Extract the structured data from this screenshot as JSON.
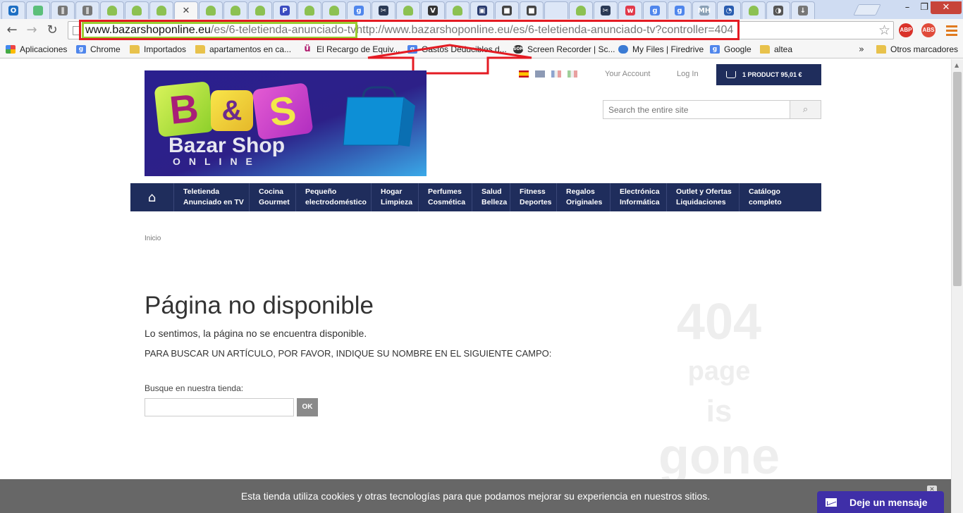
{
  "browser": {
    "tabs": [
      {
        "icon": "outlook-icon",
        "letter": "O",
        "color": "#1e6fc3"
      },
      {
        "icon": "cloud-icon",
        "letter": "",
        "color": "#5bbf7a"
      },
      {
        "icon": "doc-icon",
        "letter": "∥",
        "color": "#777777"
      },
      {
        "icon": "doc-icon",
        "letter": "∥",
        "color": "#777777"
      },
      {
        "icon": "android-icon",
        "letter": "",
        "color": "#8cc152"
      },
      {
        "icon": "android-icon",
        "letter": "",
        "color": "#8cc152"
      },
      {
        "icon": "android-icon",
        "letter": "",
        "color": "#8cc152"
      },
      {
        "icon": "close-icon",
        "letter": "✕",
        "color": "",
        "active": true
      },
      {
        "icon": "android-icon",
        "letter": "",
        "color": "#8cc152"
      },
      {
        "icon": "android-icon",
        "letter": "",
        "color": "#8cc152"
      },
      {
        "icon": "android-icon",
        "letter": "",
        "color": "#8cc152"
      },
      {
        "icon": "p-icon",
        "letter": "P",
        "color": "#3b4cc0"
      },
      {
        "icon": "android-icon",
        "letter": "",
        "color": "#8cc152"
      },
      {
        "icon": "android-icon",
        "letter": "",
        "color": "#8cc152"
      },
      {
        "icon": "google-icon",
        "letter": "g",
        "color": "#4f86ec"
      },
      {
        "icon": "scissors-icon",
        "letter": "✂",
        "color": "#2b3a55"
      },
      {
        "icon": "android-icon",
        "letter": "",
        "color": "#8cc152"
      },
      {
        "icon": "v-icon",
        "letter": "V",
        "color": "#333333"
      },
      {
        "icon": "android-icon",
        "letter": "",
        "color": "#8cc152"
      },
      {
        "icon": "chart-icon",
        "letter": "▣",
        "color": "#2a3b6e"
      },
      {
        "icon": "bag-icon",
        "letter": "■",
        "color": "#444444"
      },
      {
        "icon": "bag-icon",
        "letter": "■",
        "color": "#444444"
      },
      {
        "icon": "blank-icon",
        "letter": "",
        "color": ""
      },
      {
        "icon": "android-icon",
        "letter": "",
        "color": "#8cc152"
      },
      {
        "icon": "scissors-icon",
        "letter": "✂",
        "color": "#2b3a55"
      },
      {
        "icon": "w-icon",
        "letter": "w",
        "color": "#e23a4b"
      },
      {
        "icon": "google-icon",
        "letter": "g",
        "color": "#4f86ec"
      },
      {
        "icon": "google-icon",
        "letter": "g",
        "color": "#4f86ec"
      },
      {
        "icon": "mh-icon",
        "letter": "MH",
        "color": "#8aa0b5"
      },
      {
        "icon": "circle-icon",
        "letter": "◔",
        "color": "#2a5db0"
      },
      {
        "icon": "android-icon",
        "letter": "",
        "color": "#8cc152"
      },
      {
        "icon": "speedometer-icon",
        "letter": "◑",
        "color": "#555555"
      },
      {
        "icon": "download-icon",
        "letter": "↓",
        "color": "#777777"
      }
    ],
    "window_controls": {
      "minimize": "–",
      "maximize": "❐",
      "close": "✕"
    },
    "nav": {
      "back": "←",
      "forward": "→",
      "reload": "↻"
    },
    "url": {
      "domain": "www.bazarshoponline.eu",
      "path": "/es/6-teletienda-anunciado-tv",
      "typed": "http://www.bazarshoponline.eu/es/6-teletienda-anunciado-tv?controller=404"
    },
    "star": "☆",
    "extensions": {
      "abp": "ABP",
      "abs": "ABS"
    },
    "bookmarks": [
      {
        "icon": "apps",
        "label": "Aplicaciones"
      },
      {
        "icon": "g",
        "label": "Chrome"
      },
      {
        "icon": "folder",
        "label": "Importados"
      },
      {
        "icon": "folder",
        "label": "apartamentos en ca..."
      },
      {
        "icon": "u",
        "label": "El Recargo de Equiv..."
      },
      {
        "icon": "g",
        "label": "Gastos Deducibles d..."
      },
      {
        "icon": "som",
        "label": "Screen Recorder | Sc..."
      },
      {
        "icon": "cloud",
        "label": "My Files | Firedrive"
      },
      {
        "icon": "g",
        "label": "Google"
      },
      {
        "icon": "folder",
        "label": "altea"
      }
    ],
    "bookmarks_more": "»",
    "other_bookmarks": "Otros marcadores"
  },
  "site": {
    "logo": {
      "b": "B",
      "amp": "&",
      "s": "S",
      "name": "Bazar Shop",
      "sub": "ONLINE"
    },
    "languages": [
      "es",
      "en",
      "fr",
      "it"
    ],
    "your_account": "Your Account",
    "login": "Log In",
    "cart": "1 PRODUCT 95,01 €",
    "search_placeholder": "Search the entire site",
    "search_icon": "⌕",
    "home_icon": "⌂",
    "menu": [
      {
        "l1": "Teletienda",
        "l2": "Anunciado en TV"
      },
      {
        "l1": "Cocina",
        "l2": "Gourmet"
      },
      {
        "l1": "Pequeño",
        "l2": "electrodoméstico"
      },
      {
        "l1": "Hogar",
        "l2": "Limpieza"
      },
      {
        "l1": "Perfumes",
        "l2": "Cosmética"
      },
      {
        "l1": "Salud",
        "l2": "Belleza"
      },
      {
        "l1": "Fitness",
        "l2": "Deportes"
      },
      {
        "l1": "Regalos",
        "l2": "Originales"
      },
      {
        "l1": "Electrónica",
        "l2": "Informática"
      },
      {
        "l1": "Outlet y Ofertas",
        "l2": "Liquidaciones"
      },
      {
        "l1": "Catálogo",
        "l2": "completo"
      }
    ],
    "breadcrumb": "Inicio",
    "error": {
      "title": "Página no disponible",
      "message": "Lo sentimos, la página no se encuentra disponible.",
      "instruction": "PARA BUSCAR UN ARTÍCULO, POR FAVOR, INDIQUE SU NOMBRE EN EL SIGUIENTE CAMPO:",
      "search_label": "Busque en nuestra tienda:",
      "ok": "OK"
    },
    "big": {
      "code": "404",
      "page": "page",
      "is": "is",
      "gone": "gone"
    },
    "cookie": {
      "text": "Esta tienda utiliza cookies y otras tecnologías para que podamos mejorar su experiencia en nuestros sitios.",
      "close": "✕"
    },
    "chat": "Deje un mensaje"
  }
}
